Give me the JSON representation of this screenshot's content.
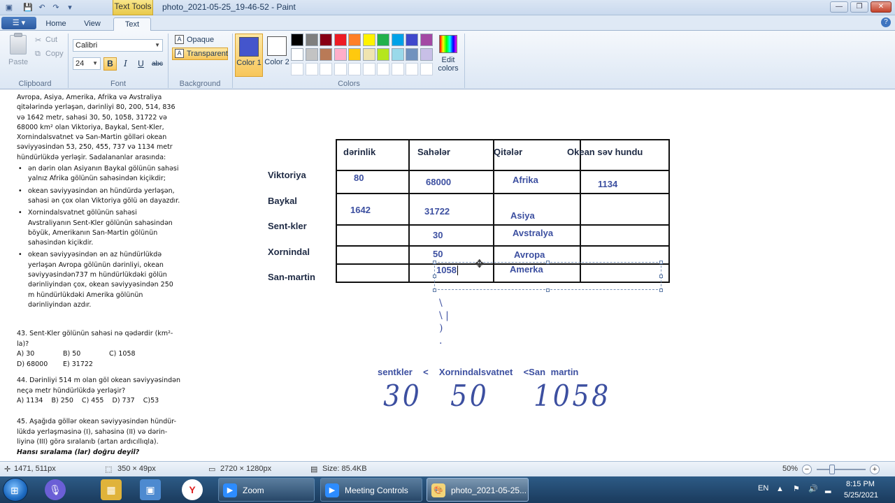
{
  "window": {
    "title": "photo_2021-05-25_19-46-52 - Paint",
    "context_tab": "Text Tools",
    "minimize": "—",
    "maximize": "❐",
    "close": "✕",
    "help": "?"
  },
  "tabs": [
    {
      "label": "Home"
    },
    {
      "label": "View"
    },
    {
      "label": "Text"
    }
  ],
  "ribbon": {
    "clipboard": {
      "paste": "Paste",
      "cut": "Cut",
      "copy": "Copy",
      "group": "Clipboard"
    },
    "font": {
      "family": "Calibri",
      "size": "24",
      "bold": "B",
      "italic": "I",
      "underline": "U",
      "strike": "abc",
      "group": "Font"
    },
    "background": {
      "opaque": "Opaque",
      "transparent": "Transparent",
      "group": "Background"
    },
    "colors": {
      "color1_label": "Color 1",
      "color2_label": "Color 2",
      "color1": "#4455cc",
      "color2": "#ffffff",
      "edit": "Edit colors",
      "group": "Colors",
      "palette_row1": [
        "#000000",
        "#7f7f7f",
        "#880015",
        "#ed1c24",
        "#ff7f27",
        "#fff200",
        "#22b14c",
        "#00a2e8",
        "#3f48cc",
        "#a349a4"
      ],
      "palette_row2": [
        "#ffffff",
        "#c3c3c3",
        "#b97a57",
        "#ffaec9",
        "#ffc90e",
        "#efe4b0",
        "#b5e61d",
        "#99d9ea",
        "#7092be",
        "#c8bfe7"
      ]
    }
  },
  "doc": {
    "intro": "Avropa, Asiya, Amerika, Afrika və Avstraliya qitələrində yerləşən, dərinliyi 80, 200, 514, 836 və 1642 metr, sahəsi 30, 50, 1058, 31722 və 68000 km² olan Viktoriya, Baykal, Sent-Kler, Xornindalsvatnet və San-Martin gölləri okean səviyyəsindən 53, 250, 455, 737 və 1134 metr hündürlükdə yerləşir. Sadalananlar arasında:",
    "bullets": [
      "ən dərin olan Asiyanın Baykal gölünün sahəsi yalnız Afrika gölünün sahəsindən kiçikdir;",
      "okean səviyyəsindən ən hündürdə yerləşən, sahəsi ən çox olan Viktoriya gölü ən dayazdır.",
      "Xornindalsvatnet gölünün sahəsi Avstraliyanın Sent-Kler gölünün sahəsindən böyük, Amerikanın San-Martin gölünün sahəsindən kiçikdir.",
      "okean səviyyəsindən ən az hündürlükdə yerləşən Avropa gölünün dərinliyi, okean səviyyəsindən737 m hündürlükdəki gölün dərinliyindən çox, okean səviyyəsindən 250 m hündürlükdəki Amerika gölünün dərinliyindən azdır."
    ],
    "q43": {
      "text": "43. Sent-Kler gölünün sahəsi nə qədərdir (km²-la)?",
      "a": "A) 30",
      "b": "B) 50",
      "c": "C) 1058",
      "d": "D) 68000",
      "e": "E) 31722"
    },
    "q44": {
      "text1": "44. Dərinliyi 514 m olan göl okean səviyyəsindən",
      "text2": "neçə metr hündürlükdə yerləşir?",
      "options": "A) 1134    B) 250    C) 455    D) 737    C)53"
    },
    "q45": {
      "l1": "45. Aşağıda göllər okean səviyyəsindən hündür-",
      "l2": "lükdə yerləşməsinə (I), sahəsinə (II) və dərin-",
      "l3": "liyinə (III) görə sıralanıb (artan ardıcıllıqla).",
      "l4": "Hansı sıralama (lar) doğru deyil?"
    }
  },
  "table": {
    "headers": [
      "dərinlik",
      "Sahələr",
      "Qitələr",
      "Okean səv hundu"
    ],
    "rows": [
      "Viktoriya",
      "Baykal",
      "Sent-kler",
      "Xornindal",
      "San-martin"
    ],
    "cells": {
      "viktoriya_depth": "80",
      "viktoriya_area": "68000",
      "viktoriya_cont": "Afrika",
      "viktoriya_alt": "1134",
      "baykal_depth": "1642",
      "baykal_area": "31722",
      "baykal_cont": "Asiya",
      "sentkler_area": "30",
      "sentkler_cont": "Avstralya",
      "xornindal_area": "50",
      "xornindal_cont": "Avropa",
      "sanmartin_area": "1058",
      "sanmartin_cont": "Amerka"
    }
  },
  "annotations": {
    "compare": "sentkler  <  Xornindalsvatnet  <San martin",
    "hand1": "30",
    "hand2": "50",
    "hand3": "1058",
    "marks": "\\\n\\ |\n)\n."
  },
  "status": {
    "cursor_pos": "1471, 511px",
    "selection_size": "350 × 49px",
    "image_size": "2720 × 1280px",
    "file_size": "Size: 85.4KB",
    "zoom": "50%"
  },
  "taskbar": {
    "zoom_label": "Zoom",
    "meeting_label": "Meeting Controls",
    "paint_label": "photo_2021-05-25...",
    "lang": "EN",
    "time": "8:15 PM",
    "date": "5/25/2021"
  }
}
